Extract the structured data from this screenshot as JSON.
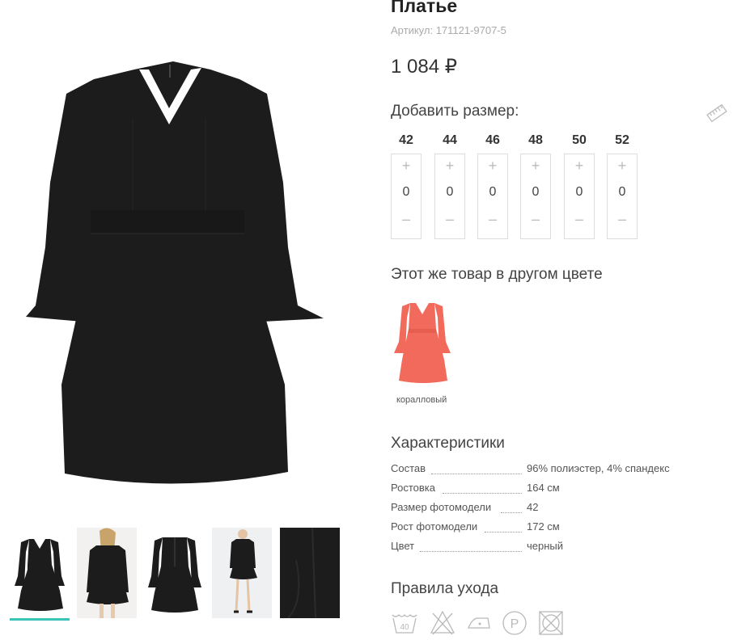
{
  "product": {
    "title": "Платье",
    "sku": "Артикул: 171121-9707-5",
    "price": "1 084 ₽"
  },
  "sizes": {
    "heading": "Добавить размер:",
    "items": [
      {
        "label": "42",
        "value": "0"
      },
      {
        "label": "44",
        "value": "0"
      },
      {
        "label": "46",
        "value": "0"
      },
      {
        "label": "48",
        "value": "0"
      },
      {
        "label": "50",
        "value": "0"
      },
      {
        "label": "52",
        "value": "0"
      }
    ],
    "plus": "+",
    "minus": "–"
  },
  "other_colors": {
    "heading": "Этот же товар в другом цвете",
    "items": [
      {
        "label": "коралловый",
        "color": "#f26a5b"
      }
    ]
  },
  "characteristics": {
    "heading": "Характеристики",
    "rows": [
      {
        "key": "Состав",
        "value": "96% полиэстер, 4% спандекс"
      },
      {
        "key": "Ростовка",
        "value": "164 см"
      },
      {
        "key": "Размер фотомодели",
        "value": "42"
      },
      {
        "key": "Рост фотомодели",
        "value": "172 см"
      },
      {
        "key": "Цвет",
        "value": "черный"
      }
    ]
  },
  "care": {
    "heading": "Правила ухода",
    "icons": [
      "wash-40-icon",
      "no-bleach-icon",
      "iron-low-icon",
      "dry-clean-p-icon",
      "no-tumble-dry-icon"
    ],
    "wash_temp": "40",
    "dry_clean_letter": "P"
  },
  "colors": {
    "dress": "#1c1c1c",
    "accent": "#3cc3b8",
    "icon_gray": "#b9b9b9"
  },
  "gallery": {
    "thumbnails": [
      "front-view",
      "model-front",
      "back-view",
      "model-full",
      "sleeve-detail"
    ],
    "active_index": 0
  }
}
